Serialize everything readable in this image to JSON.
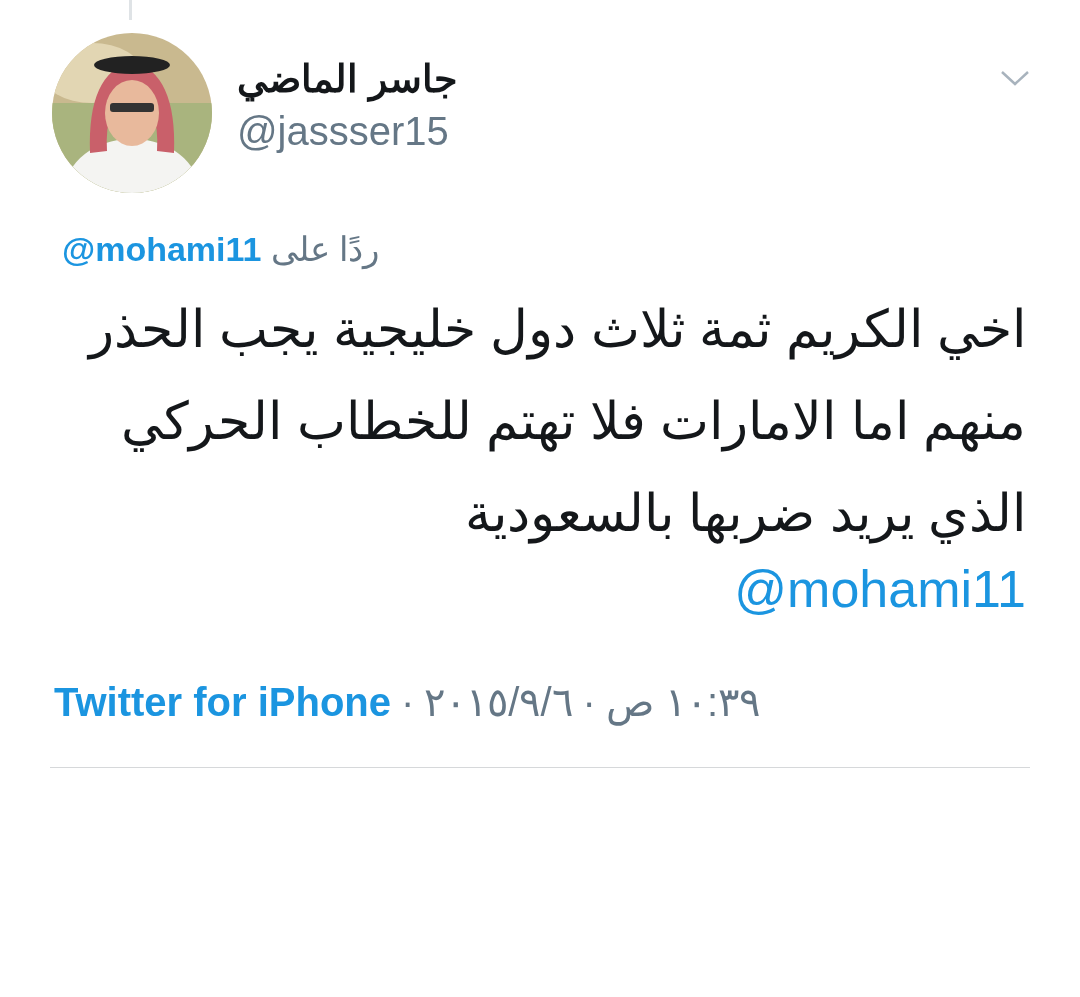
{
  "author": {
    "name": "جاسر الماضي",
    "handle": "@jassser15"
  },
  "reply_to": {
    "label": "ردًا على",
    "mention": "@mohami11"
  },
  "tweet": {
    "text": "اخي الكريم ثمة ثلاث دول خليجية يجب الحذر منهم اما الامارات فلا تهتم للخطاب الحركي الذي يريد ضربها بالسعودية",
    "mention": "@mohami11"
  },
  "meta": {
    "time": "١٠:٣٩ ص",
    "date": "٢٠١٥/٩/٦",
    "source": "Twitter for iPhone",
    "separator": "·"
  }
}
